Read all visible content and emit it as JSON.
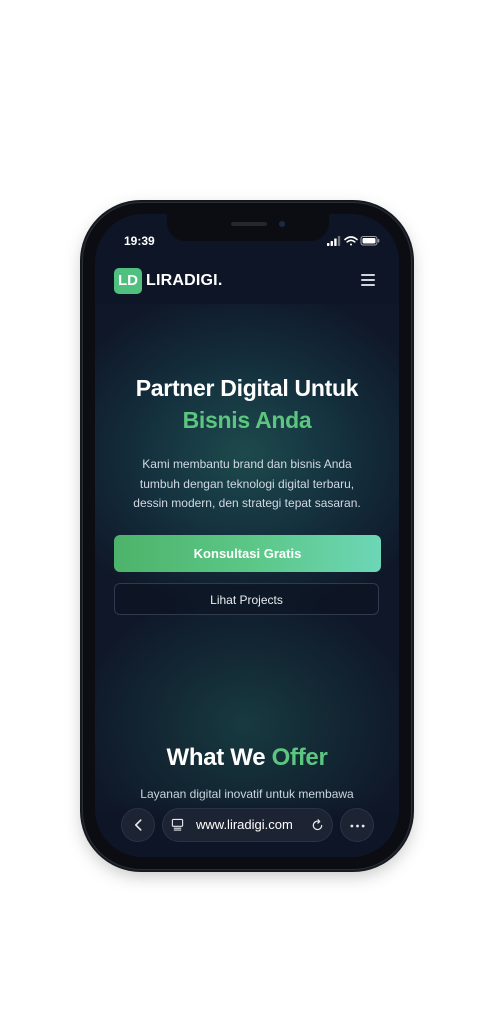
{
  "status_bar": {
    "time": "19:39"
  },
  "nav": {
    "logo_mark": "LD",
    "logo_text": "LIRADIGI."
  },
  "hero": {
    "title": "Partner Digital Untuk",
    "title_accent": "Bisnis Anda",
    "description_lines": [
      "Kami membantu brand dan bisnis Anda",
      "tumbuh dengan teknologi digital terbaru,",
      "dessin modern, den strategi tepat sasaran."
    ],
    "primary_button": "Konsultasi Gratis",
    "secondary_button": "Lihat Projects"
  },
  "offer": {
    "title_part1": "What We",
    "title_part2": "Offer",
    "description": "Layanan digital inovatif untuk membawa"
  },
  "browser": {
    "url": "www.liradigi.com"
  },
  "colors": {
    "accent_green": "#5cc57f",
    "background": "#0e1526",
    "gradient_end": "#6dd6b7"
  },
  "icons": [
    "back-chevron-icon",
    "reader-icon",
    "reload-icon",
    "more-icon",
    "menu-icon",
    "signal-icon",
    "wifi-icon",
    "battery-icon"
  ]
}
